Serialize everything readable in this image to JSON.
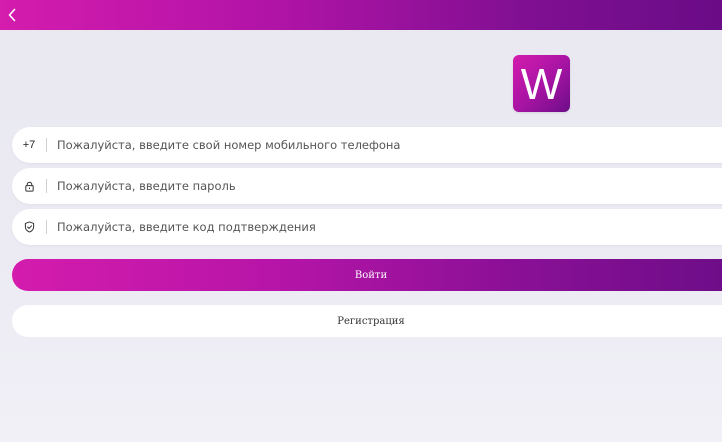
{
  "header": {
    "back_icon": "chevron-left-icon"
  },
  "logo": {
    "letter": "W"
  },
  "form": {
    "phone": {
      "prefix": "+7",
      "placeholder": "Пожалуйста, введите свой номер мобильного телефона",
      "value": ""
    },
    "password": {
      "icon": "lock-icon",
      "placeholder": "Пожалуйста, введите пароль",
      "value": ""
    },
    "code": {
      "icon": "shield-check-icon",
      "placeholder": "Пожалуйста, введите код подтверждения",
      "value": ""
    },
    "login_label": "Войти",
    "register_label": "Регистрация"
  },
  "colors": {
    "accent_start": "#d41cad",
    "accent_end": "#6d0d88",
    "background": "#eceaf2"
  }
}
